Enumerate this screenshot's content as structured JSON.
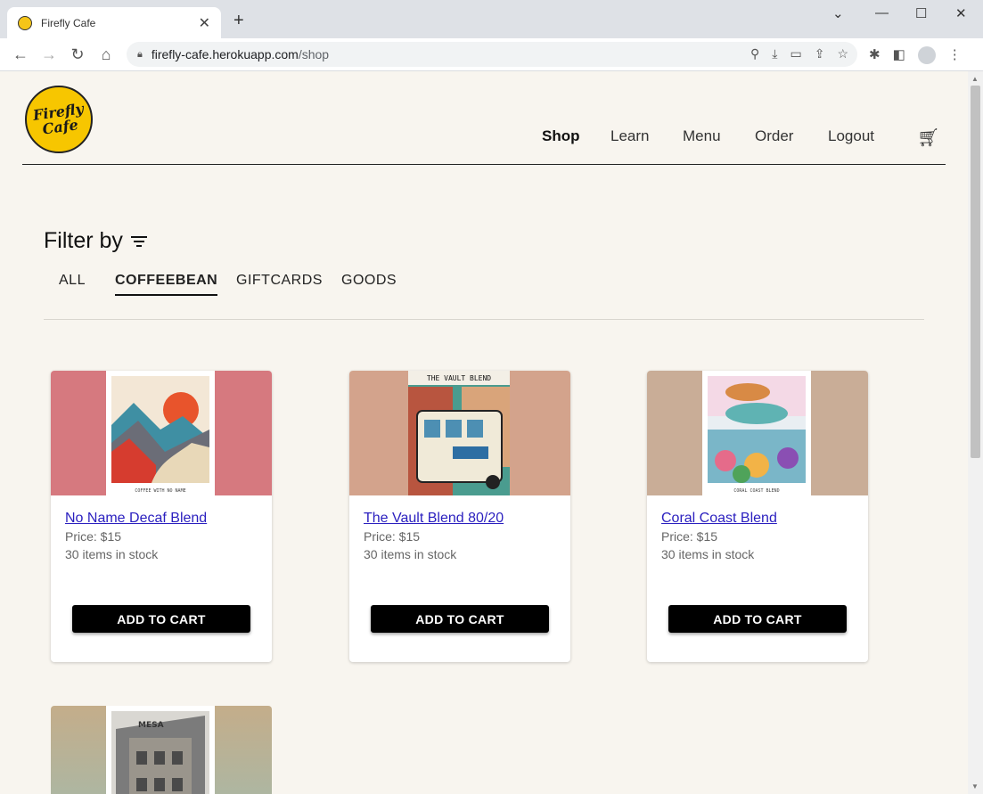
{
  "browser": {
    "tab_title": "Firefly Cafe",
    "url_host": "firefly-cafe.herokuapp.com",
    "url_path": "/shop"
  },
  "site": {
    "logo_text_1": "Firefly",
    "logo_text_2": "Cafe",
    "nav": [
      "Shop",
      "Learn",
      "Menu",
      "Order",
      "Logout"
    ],
    "active_nav": "Shop"
  },
  "filter": {
    "heading": "Filter by",
    "tabs": [
      "ALL",
      "COFFEEBEAN",
      "GIFTCARDS",
      "GOODS"
    ],
    "selected": "COFFEEBEAN"
  },
  "products": [
    {
      "name": "No Name Decaf Blend",
      "price": "Price: $15",
      "stock": "30 items in stock",
      "bag_label": "COFFEE WITH NO NAME",
      "bg": "#d6797f"
    },
    {
      "name": "The Vault Blend 80/20",
      "price": "Price: $15",
      "stock": "30 items in stock",
      "bag_label": "THE VAULT BLEND",
      "bg": "#d3a38c"
    },
    {
      "name": "Coral Coast Blend",
      "price": "Price: $15",
      "stock": "30 items in stock",
      "bag_label": "CORAL COAST BLEND",
      "bg": "#c9ad97"
    },
    {
      "name": "",
      "price": "",
      "stock": "",
      "bag_label": "MESA",
      "bg": "#bfae8f"
    }
  ],
  "add_to_cart_label": "ADD TO CART",
  "colors": {
    "link": "#2a1fbf",
    "page_bg": "#f8f5ef",
    "logo": "#f7c600"
  }
}
